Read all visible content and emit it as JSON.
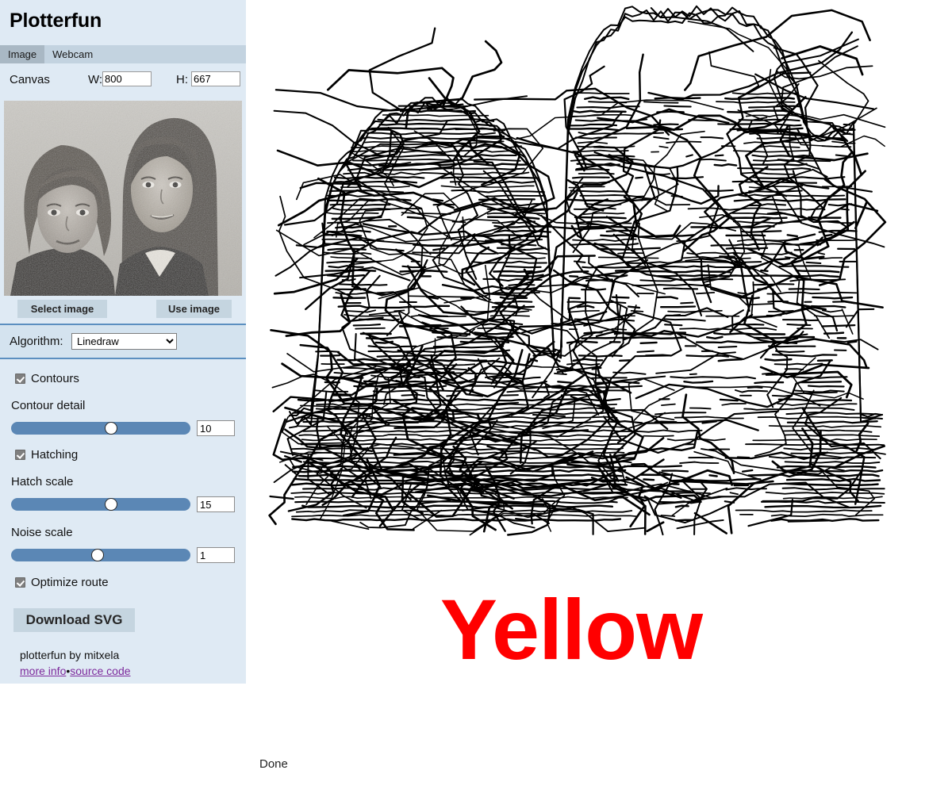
{
  "app": {
    "title": "Plotterfun"
  },
  "tabs": [
    {
      "label": "Image",
      "active": true
    },
    {
      "label": "Webcam",
      "active": false
    }
  ],
  "canvas": {
    "label": "Canvas",
    "width_label": "W:",
    "width_value": "800",
    "height_label": "H:",
    "height_value": "667"
  },
  "thumbnail": {
    "alt": "grayscale portrait photo of two children"
  },
  "image_buttons": {
    "select_label": "Select image",
    "use_label": "Use image"
  },
  "algorithm": {
    "label": "Algorithm:",
    "selected": "Linedraw",
    "options": [
      "Linedraw"
    ]
  },
  "options": {
    "contours": {
      "label": "Contours",
      "checked": true
    },
    "contour_detail": {
      "label": "Contour detail",
      "value": "10",
      "percent": 56
    },
    "hatching": {
      "label": "Hatching",
      "checked": true
    },
    "hatch_scale": {
      "label": "Hatch scale",
      "value": "15",
      "percent": 56
    },
    "noise_scale": {
      "label": "Noise scale",
      "value": "1",
      "percent": 48
    },
    "optimize_route": {
      "label": "Optimize route",
      "checked": true
    }
  },
  "download": {
    "label": "Download SVG"
  },
  "credits": {
    "text": "plotterfun by mitxela",
    "more_info_label": "more info",
    "separator": "•",
    "source_code_label": "source code"
  },
  "stroop": {
    "word": "Yellow",
    "ink_color": "#ff0000"
  },
  "status": {
    "text": "Done"
  },
  "colors": {
    "sidebar_bg": "#dfeaf4",
    "tabbar_bg": "#c3d3e0",
    "active_tab_bg": "#a9b8c4",
    "button_bg": "#c5d5e0",
    "slider_track": "#5b87b5",
    "divider": "#5b8fc0",
    "link": "#7d2a9c",
    "stroke": "#000000"
  }
}
